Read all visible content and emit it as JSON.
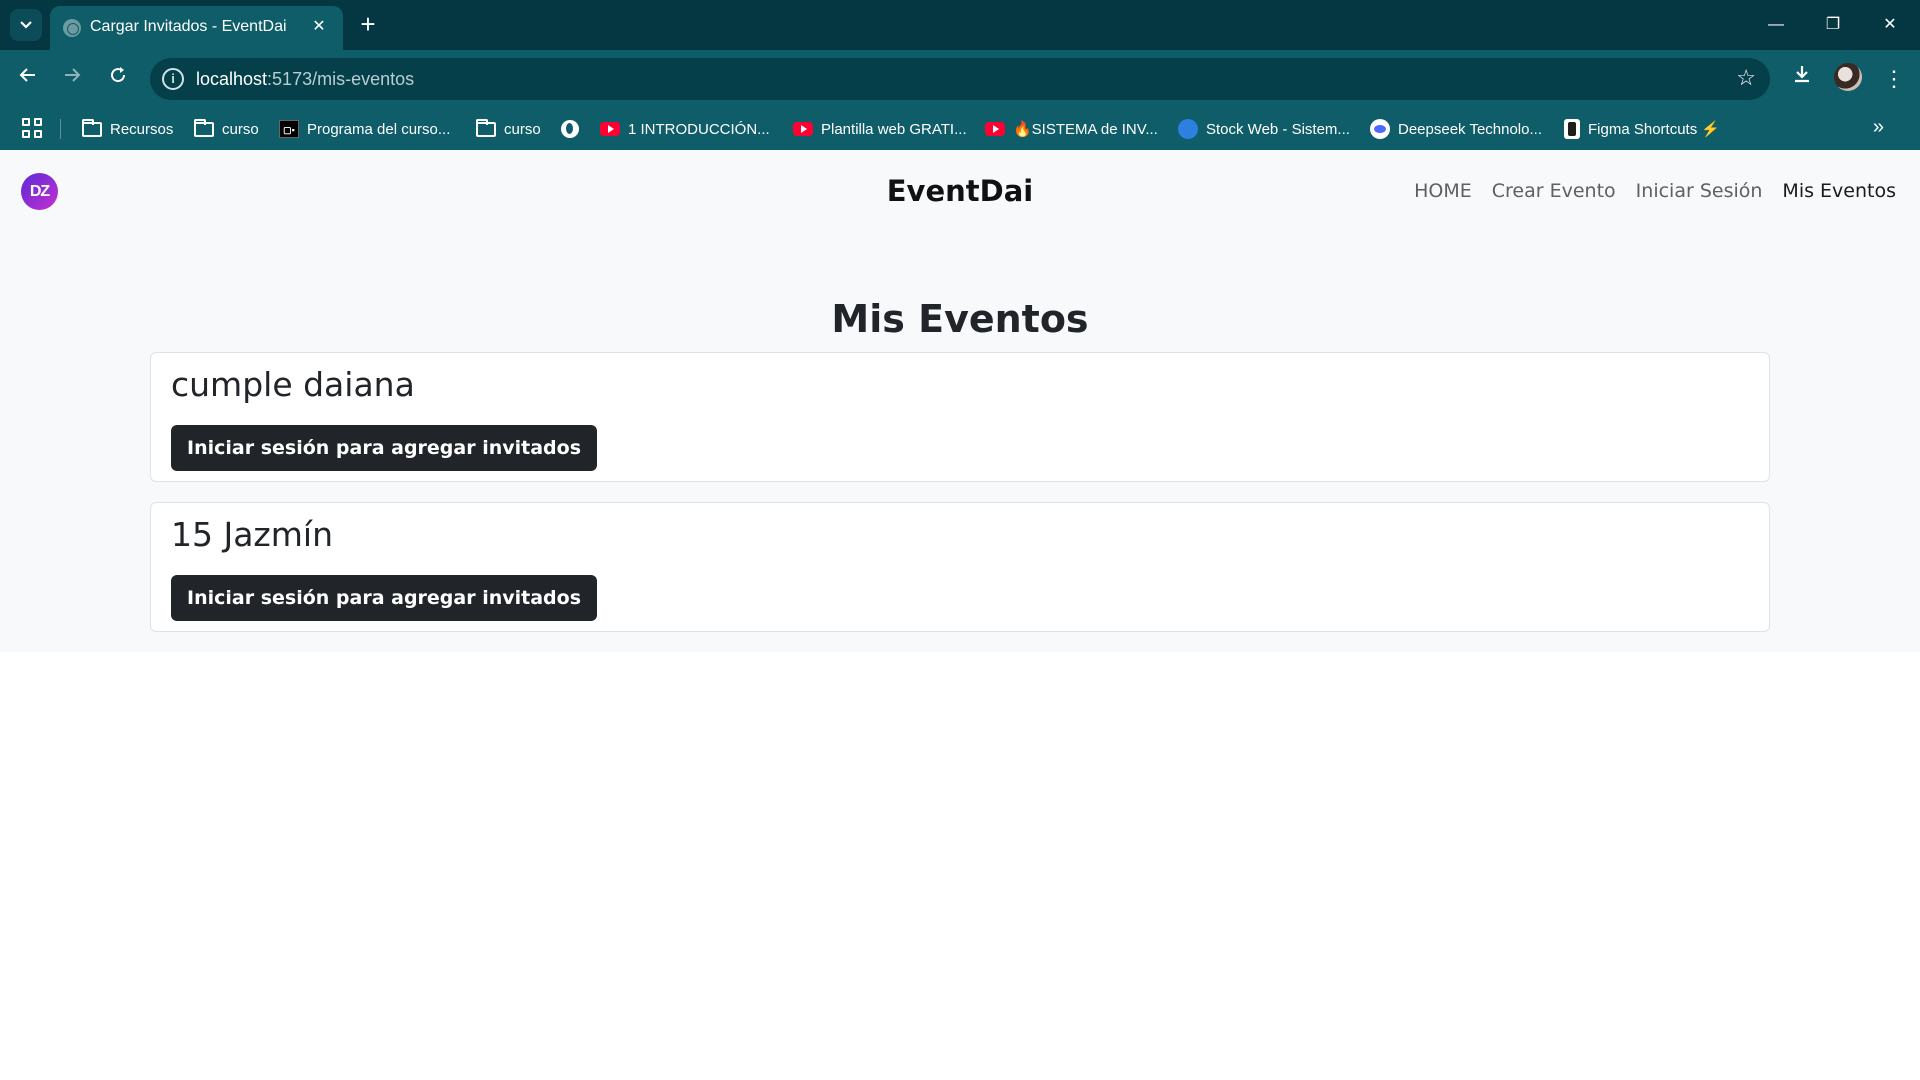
{
  "browser": {
    "tab_title": "Cargar Invitados - EventDai",
    "url_host": "localhost",
    "url_path": ":5173/mis-eventos",
    "bookmarks": [
      {
        "label": "Recursos",
        "icon": "folder-icon"
      },
      {
        "label": "curso",
        "icon": "folder-icon"
      },
      {
        "label": "Programa del curso...",
        "icon": "codo-icon"
      },
      {
        "label": "curso",
        "icon": "folder-icon"
      },
      {
        "label": "",
        "icon": "globe-icon"
      },
      {
        "label": "1 INTRODUCCIÓN...",
        "icon": "youtube-icon"
      },
      {
        "label": "Plantilla web GRATI...",
        "icon": "youtube-icon"
      },
      {
        "label": "🔥SISTEMA de INV...",
        "icon": "youtube-icon"
      },
      {
        "label": "Stock Web - Sistem...",
        "icon": "stock-icon"
      },
      {
        "label": "Deepseek Technolo...",
        "icon": "deepseek-icon"
      },
      {
        "label": "Figma Shortcuts ⚡",
        "icon": "figma-icon"
      }
    ]
  },
  "app": {
    "logo_text": "DZ",
    "brand": "EventDai",
    "nav": [
      "HOME",
      "Crear Evento",
      "Iniciar Sesión",
      "Mis Eventos"
    ],
    "active_nav": "Mis Eventos"
  },
  "main": {
    "title": "Mis Eventos",
    "events": [
      {
        "name": "cumple daiana",
        "button": "Iniciar sesión para agregar invitados"
      },
      {
        "name": "15 Jazmín",
        "button": "Iniciar sesión para agregar invitados"
      }
    ]
  },
  "colors": {
    "chrome_dark": "#043742",
    "chrome": "#0e5d68",
    "button": "#212529",
    "page_bg": "#f8f9fa"
  }
}
